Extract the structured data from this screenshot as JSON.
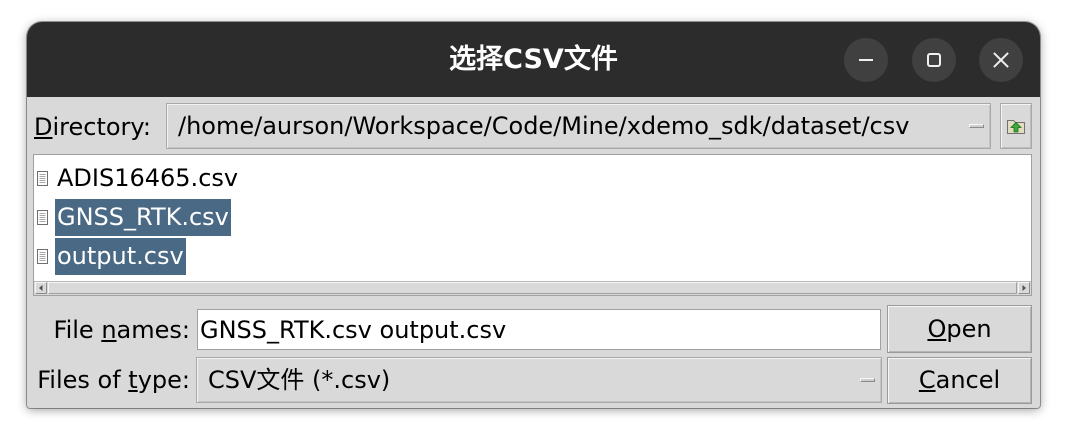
{
  "window": {
    "title": "选择CSV文件",
    "controls": [
      {
        "icon": "minimize-icon"
      },
      {
        "icon": "maximize-icon"
      },
      {
        "icon": "close-icon"
      }
    ]
  },
  "directory": {
    "label": "Directory:",
    "underline": 0,
    "value": "/home/aurson/Workspace/Code/Mine/xdemo_sdk/dataset/csv",
    "dropdown_icon": "dropdown-indicator-icon",
    "up_button_icon": "folder-up-icon"
  },
  "file_list": {
    "items": [
      {
        "name": "ADIS16465.csv",
        "selected": false,
        "icon": "file-icon"
      },
      {
        "name": "GNSS_RTK.csv",
        "selected": true,
        "icon": "file-icon"
      },
      {
        "name": "output.csv",
        "selected": true,
        "icon": "file-icon"
      }
    ],
    "scrollbar": {
      "left_icon": "scroll-left-icon",
      "right_icon": "scroll-right-icon"
    }
  },
  "file_names": {
    "label": "File names:",
    "underline": 5,
    "value": "GNSS_RTK.csv output.csv"
  },
  "file_type": {
    "label": "Files of type:",
    "underline": 9,
    "value": "CSV文件 (*.csv)",
    "dropdown_icon": "dropdown-indicator-icon"
  },
  "buttons": {
    "open": {
      "label": "Open",
      "underline": 0
    },
    "cancel": {
      "label": "Cancel",
      "underline": 0
    }
  },
  "colors": {
    "title_bar": "#2c2c2c",
    "window_button": "#404040",
    "dialog_background": "#d9d9d9",
    "list_background": "#ffffff",
    "selection_background": "#4a6984",
    "selection_text": "#ffffff"
  }
}
